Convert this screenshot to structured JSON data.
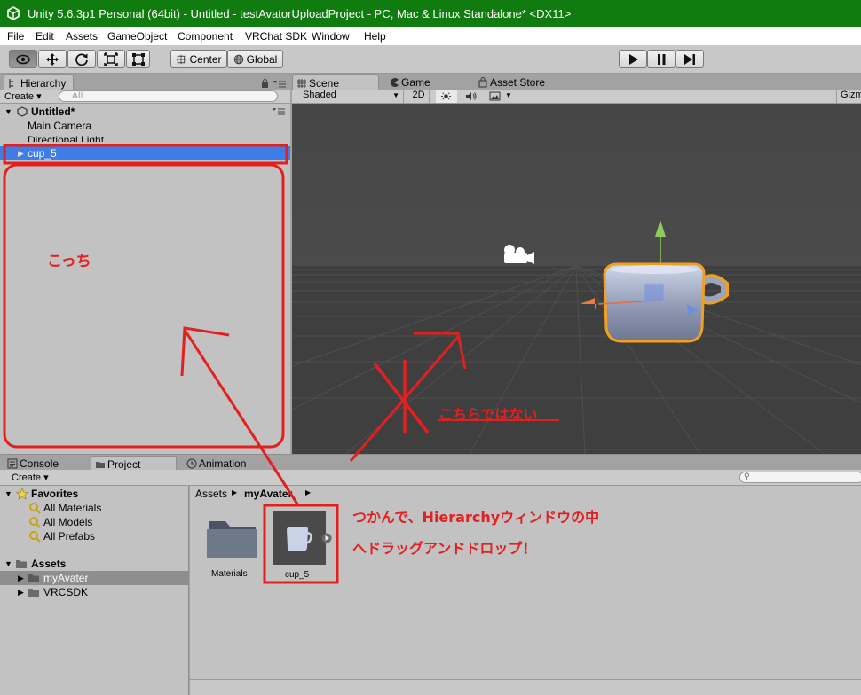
{
  "window": {
    "title": "Unity 5.6.3p1 Personal (64bit) - Untitled - testAvatorUploadProject - PC, Mac & Linux Standalone* <DX11>"
  },
  "menu": [
    "File",
    "Edit",
    "Assets",
    "GameObject",
    "Component",
    "VRChat SDK",
    "Window",
    "Help"
  ],
  "toolbar": {
    "tools": [
      "view-tool",
      "move-tool",
      "rotate-tool",
      "scale-tool",
      "rect-tool"
    ],
    "pivot": "Center",
    "space": "Global",
    "play": [
      "play",
      "pause",
      "step"
    ]
  },
  "hierarchy": {
    "tab": "Hierarchy",
    "create": "Create",
    "search_placeholder": "All",
    "scene": "Untitled*",
    "items": [
      "Main Camera",
      "Directional Light",
      "cup_5"
    ]
  },
  "scene_tabs": {
    "scene": "Scene",
    "game": "Game",
    "store": "Asset Store",
    "shading": "Shaded",
    "mode2d": "2D",
    "gizmos": "Gizm"
  },
  "bottom_tabs": [
    "Console",
    "Project",
    "Animation"
  ],
  "project": {
    "create": "Create",
    "favorites_label": "Favorites",
    "favorites": [
      "All Materials",
      "All Models",
      "All Prefabs"
    ],
    "assets_label": "Assets",
    "assets": [
      "myAvater",
      "VRCSDK"
    ],
    "breadcrumb_root": "Assets",
    "breadcrumb_current": "myAvater",
    "files": [
      "Materials",
      "cup_5"
    ]
  },
  "annotations": {
    "here": "こっち",
    "not_here": "こちらではない",
    "instruction_1": "つかんで、Hierarchyウィンドウの中",
    "instruction_2": "へドラッグアンドドロップ！"
  },
  "colors": {
    "titlebar": "#107c10",
    "selection": "#3e7ce6",
    "annotation_red": "#e32020",
    "scene_bg": "#454545",
    "selection_outline": "#f0a020"
  }
}
